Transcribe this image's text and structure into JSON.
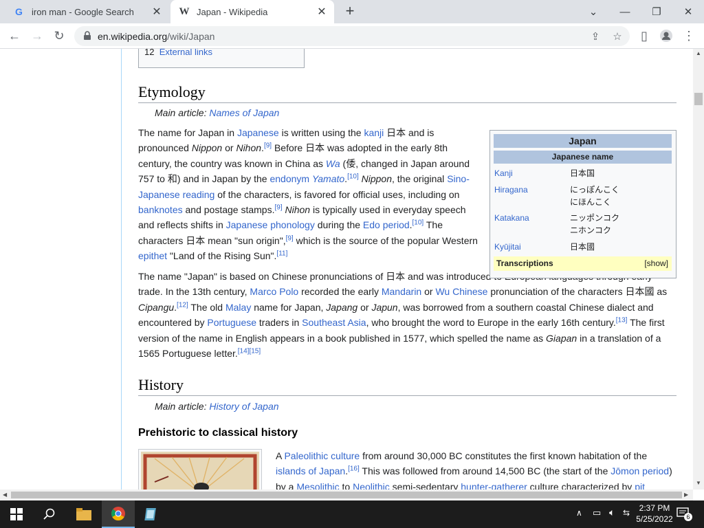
{
  "browser": {
    "tabs": [
      {
        "title": "iron man - Google Search",
        "favicon": "google-icon"
      },
      {
        "title": "Japan - Wikipedia",
        "favicon": "wikipedia-icon"
      }
    ],
    "url_host": "en.wikipedia.org",
    "url_path": "/wiki/Japan"
  },
  "toc": {
    "num": "12",
    "label": "External links"
  },
  "etymology": {
    "heading": "Etymology",
    "hatnote_prefix": "Main article: ",
    "hatnote_link": "Names of Japan"
  },
  "infobox": {
    "title": "Japan",
    "subtitle": "Japanese name",
    "rows": [
      {
        "key": "Kanji",
        "value": "日本国"
      },
      {
        "key": "Hiragana",
        "value": "にっぽんこく",
        "value2": "にほんこく"
      },
      {
        "key": "Katakana",
        "value": "ニッポンコク",
        "value2": "ニホンコク"
      },
      {
        "key": "Kyūjitai",
        "value": "日本國"
      }
    ],
    "transcriptions": "Transcriptions",
    "show": "[show]"
  },
  "history": {
    "heading": "History",
    "hatnote_prefix": "Main article: ",
    "hatnote_link": "History of Japan",
    "subheading": "Prehistoric to classical history"
  },
  "taskbar": {
    "time": "2:37 PM",
    "date": "5/25/2022",
    "notifications": "6"
  }
}
